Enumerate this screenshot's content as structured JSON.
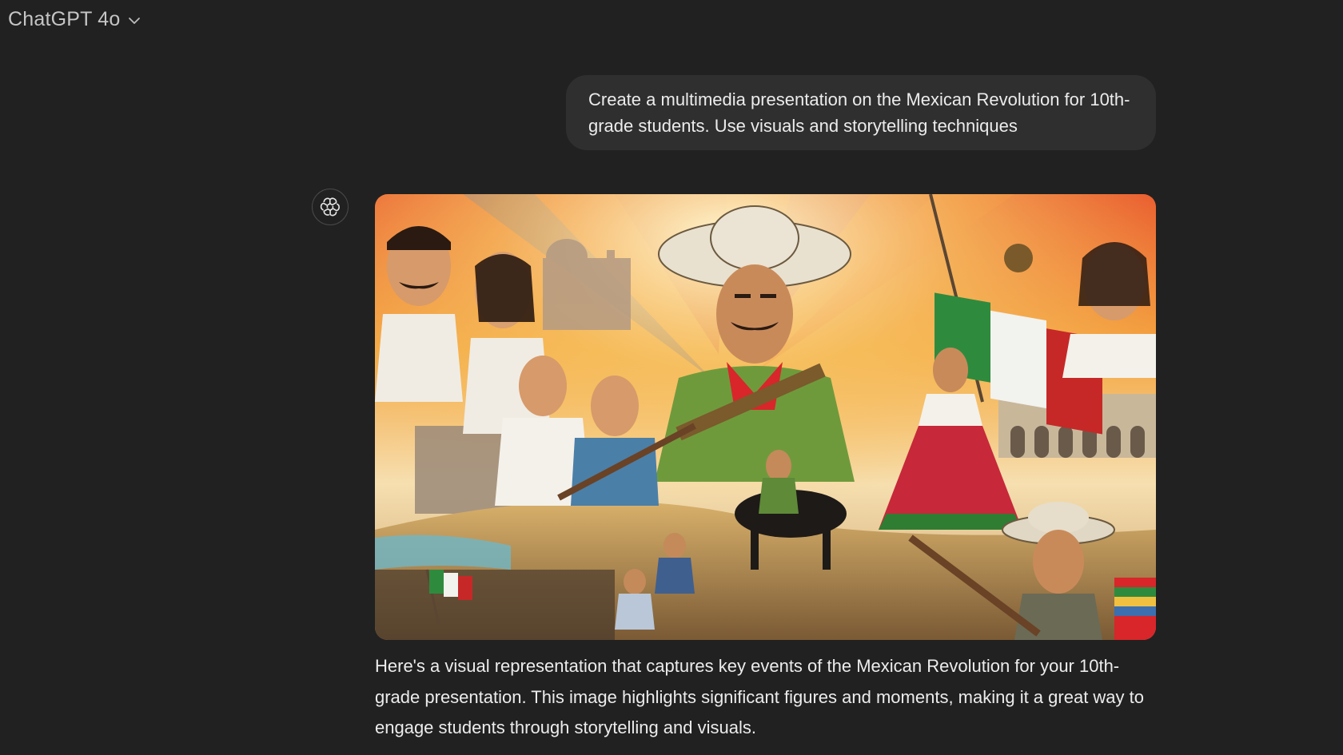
{
  "header": {
    "model_name": "ChatGPT 4o",
    "dropdown_icon": "chevron-down-icon"
  },
  "conversation": {
    "user_message": "Create a multimedia presentation on the Mexican Revolution for 10th-grade students. Use visuals and storytelling techniques",
    "assistant_avatar_icon": "openai-logo-icon",
    "assistant_text": "Here's a visual representation that captures key events of the Mexican Revolution for your 10th-grade presentation. This image highlights significant figures and moments, making it a great way to engage students through storytelling and visuals."
  },
  "colors": {
    "background": "#212121",
    "user_bubble": "#2f2f2f",
    "text": "#ececec",
    "flag_green": "#2e7d32",
    "flag_red": "#c62828"
  }
}
